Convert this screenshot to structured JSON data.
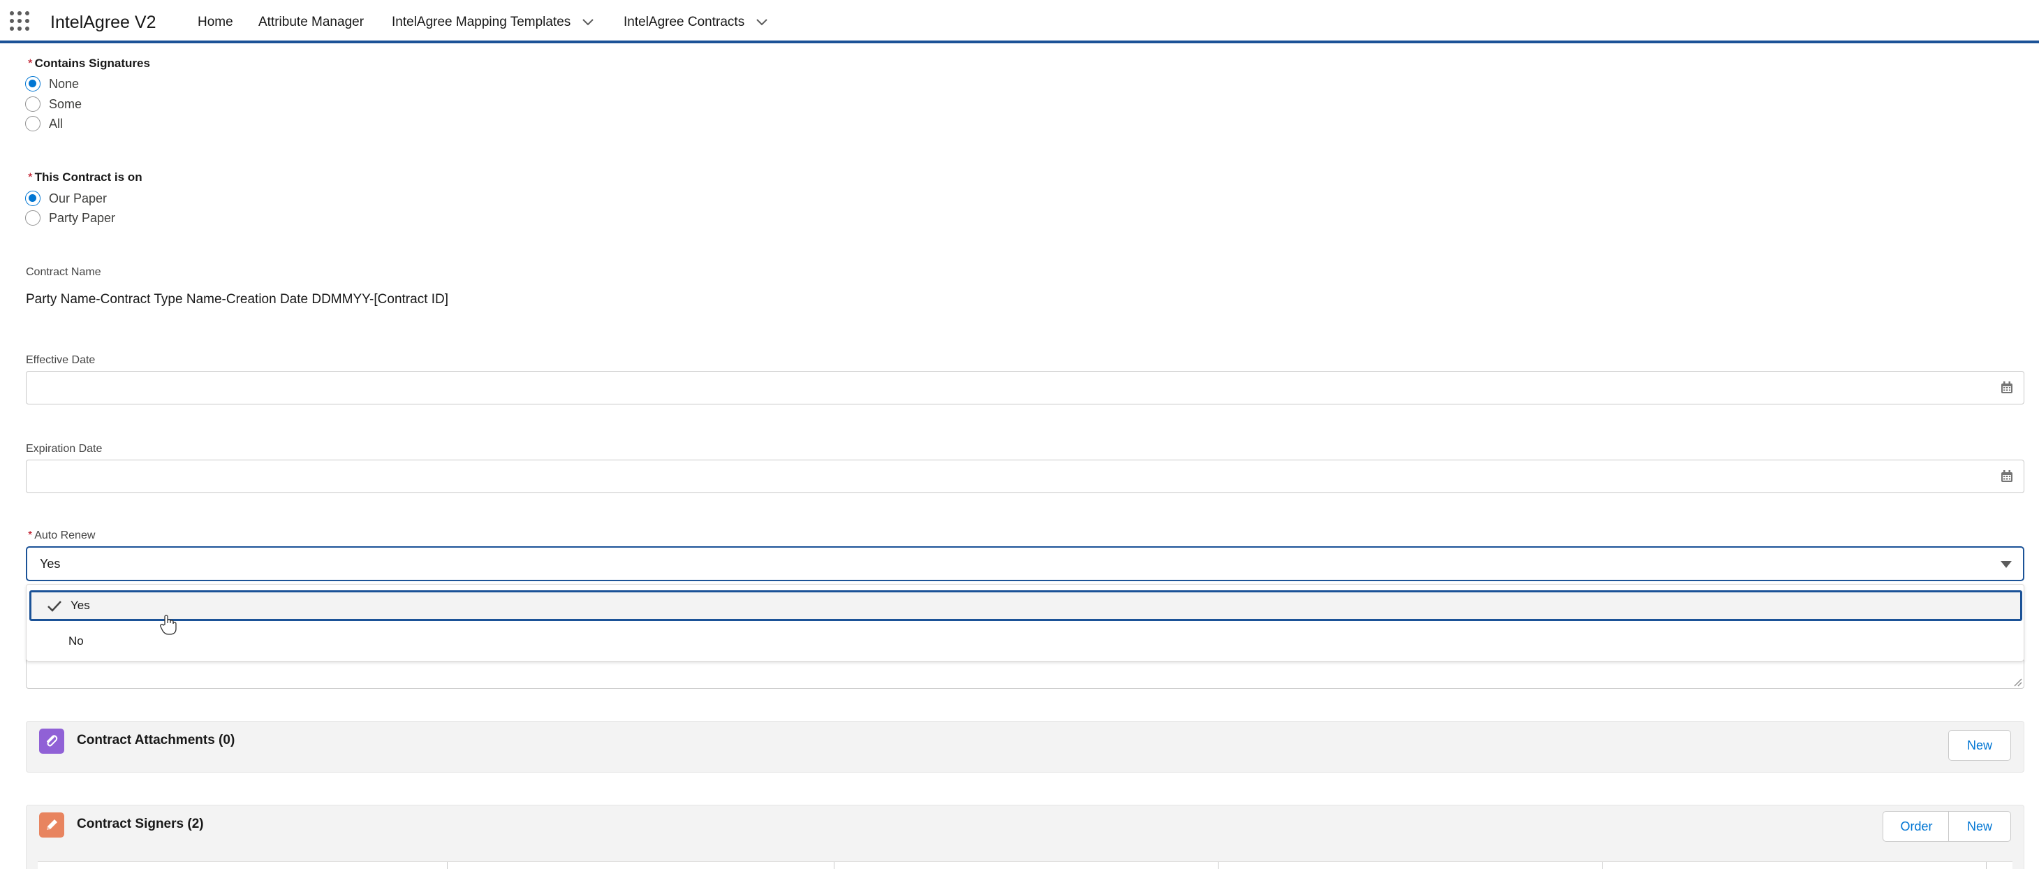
{
  "app": {
    "name": "IntelAgree V2"
  },
  "nav": {
    "home": "Home",
    "attribute_manager": "Attribute Manager",
    "mapping_templates": "IntelAgree Mapping Templates",
    "contracts": "IntelAgree Contracts"
  },
  "form": {
    "contains_signatures": {
      "required_mark": "*",
      "label": "Contains Signatures",
      "options": [
        "None",
        "Some",
        "All"
      ],
      "selected": "None"
    },
    "contract_on": {
      "required_mark": "*",
      "label": "This Contract is on",
      "options": [
        "Our Paper",
        "Party Paper"
      ],
      "selected": "Our Paper"
    },
    "contract_name": {
      "label": "Contract Name",
      "value": "Party Name-Contract Type Name-Creation Date DDMMYY-[Contract ID]"
    },
    "effective_date": {
      "label": "Effective Date",
      "value": ""
    },
    "expiration_date": {
      "label": "Expiration Date",
      "value": ""
    },
    "auto_renew": {
      "required_mark": "*",
      "label": "Auto Renew",
      "value": "Yes",
      "options": [
        "Yes",
        "No"
      ]
    }
  },
  "related": {
    "attachments": {
      "title": "Contract Attachments (0)",
      "new_label": "New"
    },
    "signers": {
      "title": "Contract Signers (2)",
      "order_label": "Order",
      "new_label": "New"
    }
  },
  "colors": {
    "brand_blue": "#1b5297",
    "link_blue": "#0176d3",
    "required_red": "#ba0517",
    "attachment_icon_bg": "#9061d6",
    "signer_icon_bg": "#e8845f"
  },
  "icons": {
    "launcher": "app-launcher-icon",
    "chevron": "chevron-down-icon",
    "calendar": "calendar-icon",
    "caret": "caret-down-icon",
    "check": "check-icon",
    "paperclip": "paperclip-icon",
    "pencil": "pencil-icon"
  }
}
